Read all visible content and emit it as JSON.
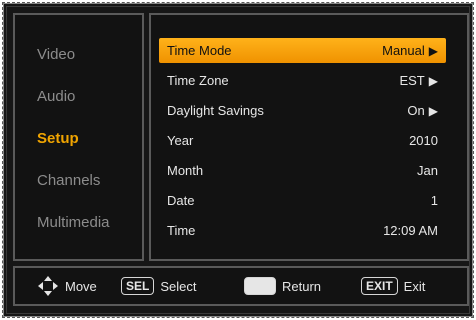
{
  "sidebar": {
    "items": [
      {
        "label": "Video"
      },
      {
        "label": "Audio"
      },
      {
        "label": "Setup"
      },
      {
        "label": "Channels"
      },
      {
        "label": "Multimedia"
      }
    ],
    "active_index": 2
  },
  "settings": {
    "rows": [
      {
        "label": "Time Mode",
        "value": "Manual"
      },
      {
        "label": "Time Zone",
        "value": "EST"
      },
      {
        "label": "Daylight Savings",
        "value": "On"
      },
      {
        "label": "Year",
        "value": "2010"
      },
      {
        "label": "Month",
        "value": "Jan"
      },
      {
        "label": "Date",
        "value": "1"
      },
      {
        "label": "Time",
        "value": "12:09 AM"
      }
    ]
  },
  "footer": {
    "move_label": "Move",
    "select_key": "SEL",
    "select_label": "Select",
    "return_label": "Return",
    "exit_key": "EXIT",
    "exit_label": "Exit"
  },
  "colors": {
    "accent": "#f0a400",
    "highlight": "#ffb21a",
    "text": "#e6e6e6",
    "muted": "#8c8c8c",
    "background": "#161616"
  }
}
